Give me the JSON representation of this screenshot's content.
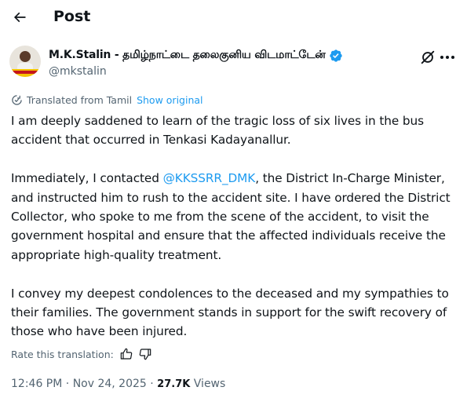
{
  "header": {
    "title": "Post",
    "back_icon": "arrow-left-icon"
  },
  "author": {
    "name": "M.K.Stalin - தமிழ்நாட்டை தலைகுனிய விடமாட்டேன்",
    "handle": "@mkstalin",
    "verified": true,
    "verified_color": "#1d9bf0"
  },
  "translation": {
    "label": "Translated from Tamil",
    "show_original": "Show original",
    "rate_label": "Rate this translation:"
  },
  "tweet": {
    "para1": "I am deeply saddened to learn of the tragic loss of six lives in the bus accident that occurred in Tenkasi Kadayanallur.",
    "para2_before": "Immediately, I contacted ",
    "mention": "@KKSSRR_DMK",
    "para2_after": ", the District In-Charge Minister, and instructed him to rush to the accident site. I have ordered the District Collector, who spoke to me from the scene of the accident, to visit the government hospital and ensure that the affected individuals receive the appropriate high-quality treatment.",
    "para3": "I convey my deepest condolences to the deceased and my sympathies to their families. The government stands in support for the swift recovery of those who have been injured."
  },
  "meta": {
    "time": "12:46 PM",
    "separator": " · ",
    "date": "Nov 24, 2025",
    "separator2": " · ",
    "views_count": "27.7K",
    "views_label": " Views"
  },
  "colors": {
    "accent": "#1d9bf0",
    "text": "#0f1419",
    "muted": "#536471"
  }
}
